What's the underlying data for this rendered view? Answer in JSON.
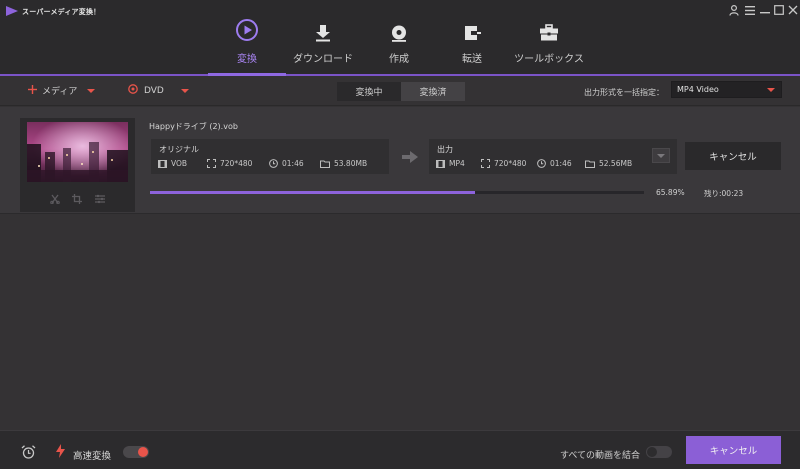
{
  "app": {
    "title": "スーパーメディア変換！"
  },
  "nav": {
    "tabs": [
      {
        "label": "変換",
        "icon": "convert-icon",
        "active": true
      },
      {
        "label": "ダウンロード",
        "icon": "download-icon",
        "active": false
      },
      {
        "label": "作成",
        "icon": "disc-icon",
        "active": false
      },
      {
        "label": "転送",
        "icon": "transfer-icon",
        "active": false
      },
      {
        "label": "ツールボックス",
        "icon": "toolbox-icon",
        "active": false
      }
    ]
  },
  "toolbar": {
    "media_label": "メディア",
    "dvd_label": "DVD",
    "tabs": [
      {
        "label": "変換中",
        "selected": true
      },
      {
        "label": "変換済",
        "selected": false
      }
    ],
    "format_label": "出力形式を一括指定：",
    "format_value": "MP4 Video"
  },
  "job": {
    "file_name": "Happyドライブ (2).vob",
    "original": {
      "title": "オリジナル",
      "format": "VOB",
      "resolution": "720*480",
      "duration": "01:46",
      "size": "53.80MB"
    },
    "output": {
      "title": "出力",
      "format": "MP4",
      "resolution": "720*480",
      "duration": "01:46",
      "size": "52.56MB"
    },
    "cancel_label": "キャンセル",
    "progress": 65.89,
    "progress_text": "65.89%",
    "remaining_text": "残り:00:23"
  },
  "bottom": {
    "speed_label": "高速変換",
    "speed_on": true,
    "merge_label": "すべての動画を結合",
    "merge_on": false,
    "cancel_all_label": "キャンセル"
  },
  "colors": {
    "accent": "#8b5fd6",
    "toggle_on": "#e8544a",
    "background": "#343234"
  }
}
